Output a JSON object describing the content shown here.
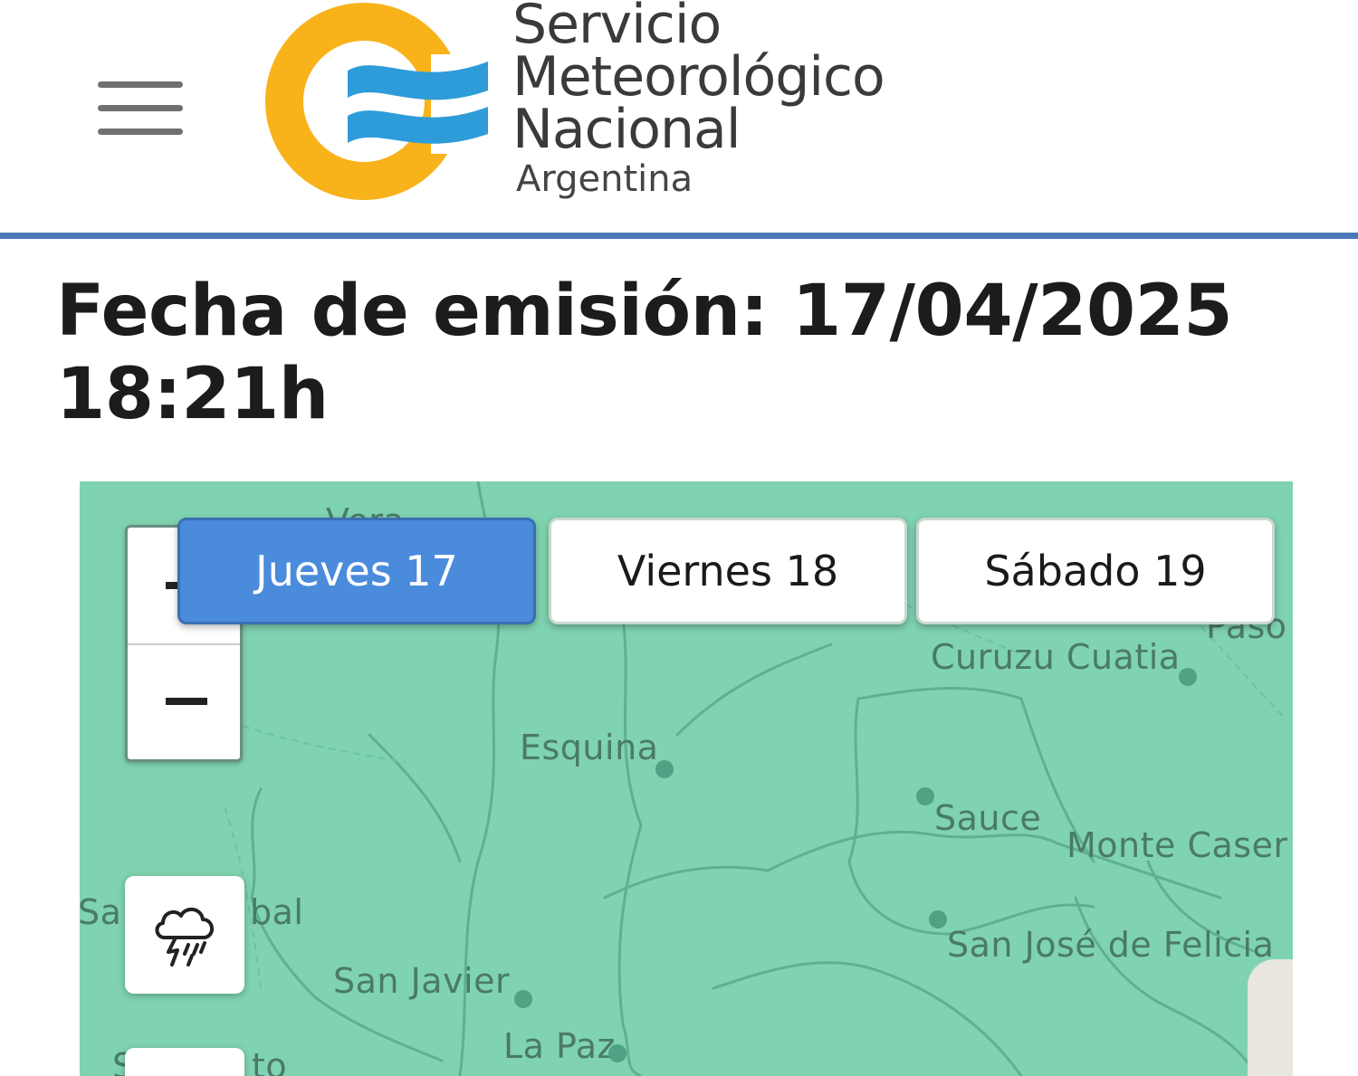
{
  "header": {
    "menu_icon": "hamburger-menu-icon",
    "logo": {
      "line1": "Servicio",
      "line2": "Meteorológico",
      "line3": "Nacional",
      "subtitle": "Argentina",
      "colors": {
        "ring": "#f8b31b",
        "stripes": "#2e9cd8"
      }
    },
    "rule_color": "#4a78b8"
  },
  "issue": {
    "title": "Fecha de emisión: 17/04/2025 18:21h"
  },
  "map": {
    "background_color": "#7fd3b1",
    "zoom": {
      "in_icon": "plus-icon",
      "out_icon": "minus-icon"
    },
    "tabs": [
      {
        "label": "Jueves 17",
        "active": true
      },
      {
        "label": "Viernes 18",
        "active": false
      },
      {
        "label": "Sábado 19",
        "active": false
      }
    ],
    "active_tab_color": "#4a8bdc",
    "layer_button_icon": "thunderstorm-icon",
    "places": {
      "paso": "Paso",
      "curuzu_cuatia": "Curuzu Cuatia",
      "esquina": "Esquina",
      "sauce": "Sauce",
      "monte_caseros": "Monte Caser",
      "san_cristobal_a": "Sa",
      "san_cristobal_b": "bal",
      "san_jose_feliciano": "San José de Felicia",
      "san_javier": "San Javier",
      "la_paz": "La Paz",
      "vera": "Vera",
      "san_justo_a": "S",
      "san_justo_b": "to"
    }
  }
}
